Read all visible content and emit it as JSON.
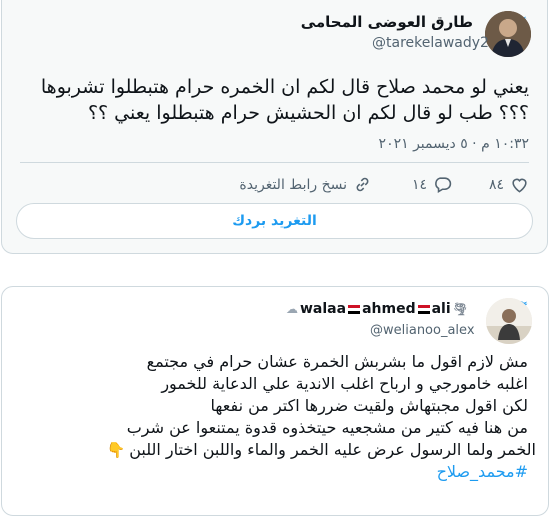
{
  "tweet1": {
    "author_name": "طارق العوضى المحامى",
    "author_handle": "@tarekelawady2",
    "text_lines": [
      "يعني لو محمد صلاح قال لكم ان الخمره حرام هتبطلوا تشربوها",
      "؟؟؟ طب لو قال لكم ان الحشيش حرام هتبطلوا يعني ؟؟"
    ],
    "timestamp": "١٠:٣٢ م · ٥ ديسمبر ٢٠٢١",
    "likes": "٨٤",
    "retweets": "١٤",
    "copy_link_label": "نسخ رابط التغريدة",
    "reply_button_label": "التغريد بردك",
    "icons": {
      "bird": "twitter-bird-icon",
      "heart": "heart-icon",
      "reply": "reply-icon",
      "link": "link-icon"
    },
    "colors": {
      "accent": "#1d9bf0",
      "muted": "#536471",
      "border": "#cfd9de"
    }
  },
  "tweet2": {
    "author_name": "walaa ahmed ali",
    "author_name_parts": {
      "first": "walaa",
      "middle": "ahmed",
      "last": "ali"
    },
    "author_handle": "@welianoo_alex",
    "text_lines": [
      "مش لازم اقول ما بشربش الخمرة عشان حرام في مجتمع",
      "اغلبه خامورجي و ارباح اغلب الاندية علي الدعاية للخمور",
      "لكن اقول مجبتهاش ولقيت ضررها اكتر من نفعها",
      "من هنا فيه كتير من مشجعيه حيتخذوه قدوة يمتنعوا عن شرب",
      "الخمر ولما الرسول عرض عليه الخمر والماء واللبن اختار اللبن"
    ],
    "hashtag": "#محمد_صلاح",
    "icons": {
      "bird": "twitter-bird-icon",
      "flag": "egypt-flag-icon",
      "tornado": "tornado-icon",
      "snow": "cloud-icon",
      "hand": "pointing-down-hand-icon"
    }
  }
}
